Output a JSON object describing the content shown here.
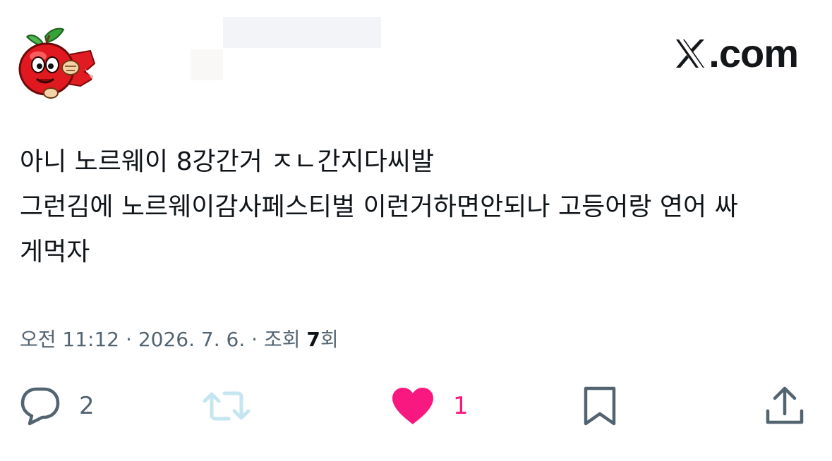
{
  "brand": {
    "logo_text": ".com"
  },
  "tweet": {
    "lines": [
      "아니 노르웨이 8강간거 ㅈㄴ간지다씨발",
      "그런김에 노르웨이감사페스티벌 이런거하면안되나 고등어랑 연어 싸",
      "게먹자"
    ],
    "time": "오전 11:12",
    "separator": "·",
    "date": "2026. 7. 6.",
    "views_label": "조회",
    "views_count": "7",
    "views_suffix": "회"
  },
  "actions": {
    "reply_count": "2",
    "retweet_count": "",
    "like_count": "1",
    "reply_icon": "speech-bubble-icon",
    "retweet_icon": "retweet-arrows-icon",
    "like_icon": "heart-icon",
    "bookmark_icon": "bookmark-icon",
    "share_icon": "share-upload-icon"
  },
  "colors": {
    "text": "#0f1419",
    "meta": "#536471",
    "like": "#f91880",
    "retweet_disabled": "#c5e6f0",
    "icon": "#536471"
  }
}
